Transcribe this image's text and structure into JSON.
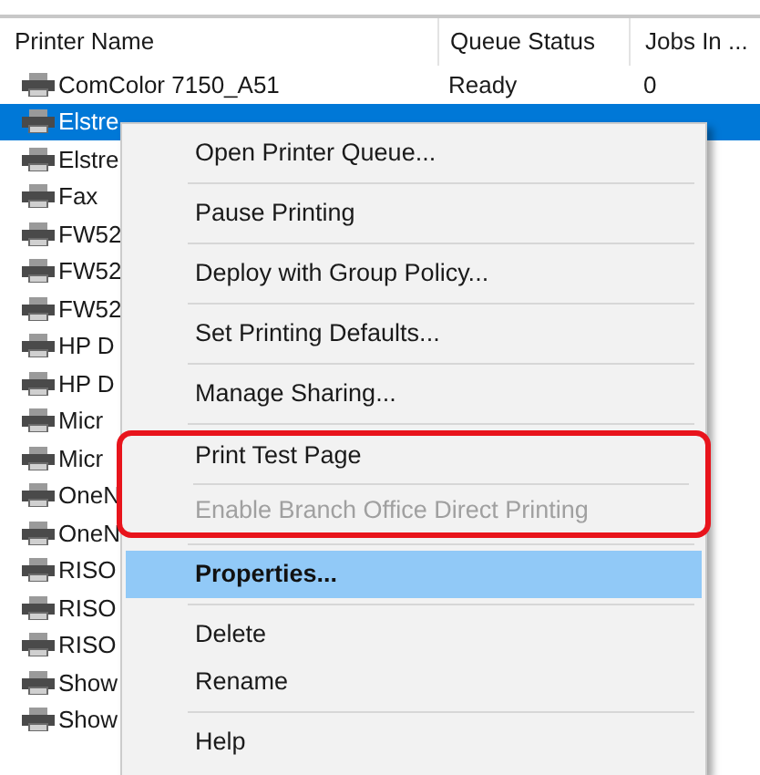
{
  "table": {
    "columns": [
      "Printer Name",
      "Queue Status",
      "Jobs In ..."
    ],
    "rows": [
      {
        "name": "ComColor 7150_A51",
        "status": "Ready",
        "jobs": "0",
        "selected": false
      },
      {
        "name": "Elstre",
        "selected": true
      },
      {
        "name": "Elstre",
        "selected": false
      },
      {
        "name": "Fax",
        "selected": false
      },
      {
        "name": "FW52",
        "selected": false
      },
      {
        "name": "FW52",
        "selected": false
      },
      {
        "name": "FW52",
        "selected": false
      },
      {
        "name": "HP D",
        "selected": false
      },
      {
        "name": "HP D",
        "selected": false
      },
      {
        "name": "Micr",
        "selected": false
      },
      {
        "name": "Micr",
        "selected": false
      },
      {
        "name": "OneN",
        "selected": false
      },
      {
        "name": "OneN",
        "selected": false
      },
      {
        "name": "RISO",
        "selected": false
      },
      {
        "name": "RISO",
        "selected": false
      },
      {
        "name": "RISO",
        "selected": false
      },
      {
        "name": "Show",
        "selected": false
      },
      {
        "name": "Show",
        "selected": false
      }
    ]
  },
  "context_menu": {
    "items": [
      {
        "kind": "item",
        "label": "Open Printer Queue...",
        "disabled": false,
        "selected": false,
        "highlighted": false
      },
      {
        "kind": "separator"
      },
      {
        "kind": "item",
        "label": "Pause Printing",
        "disabled": false,
        "selected": false,
        "highlighted": false
      },
      {
        "kind": "separator"
      },
      {
        "kind": "item",
        "label": "Deploy with Group Policy...",
        "disabled": false,
        "selected": false,
        "highlighted": false
      },
      {
        "kind": "separator"
      },
      {
        "kind": "item",
        "label": "Set Printing Defaults...",
        "disabled": false,
        "selected": false,
        "highlighted": false
      },
      {
        "kind": "separator"
      },
      {
        "kind": "item",
        "label": "Manage Sharing...",
        "disabled": false,
        "selected": false,
        "highlighted": false
      },
      {
        "kind": "separator"
      },
      {
        "kind": "item",
        "label": "Print Test Page",
        "disabled": false,
        "selected": false,
        "highlighted": true
      },
      {
        "kind": "separator"
      },
      {
        "kind": "item",
        "label": "Enable Branch Office Direct Printing",
        "disabled": true,
        "selected": false,
        "highlighted": true
      },
      {
        "kind": "separator"
      },
      {
        "kind": "item",
        "label": "Properties...",
        "disabled": false,
        "selected": true,
        "highlighted": false
      },
      {
        "kind": "separator"
      },
      {
        "kind": "item",
        "label": "Delete",
        "disabled": false,
        "selected": false,
        "highlighted": false
      },
      {
        "kind": "item",
        "label": "Rename",
        "disabled": false,
        "selected": false,
        "highlighted": false
      },
      {
        "kind": "separator"
      },
      {
        "kind": "item",
        "label": "Help",
        "disabled": false,
        "selected": false,
        "highlighted": false
      }
    ]
  }
}
